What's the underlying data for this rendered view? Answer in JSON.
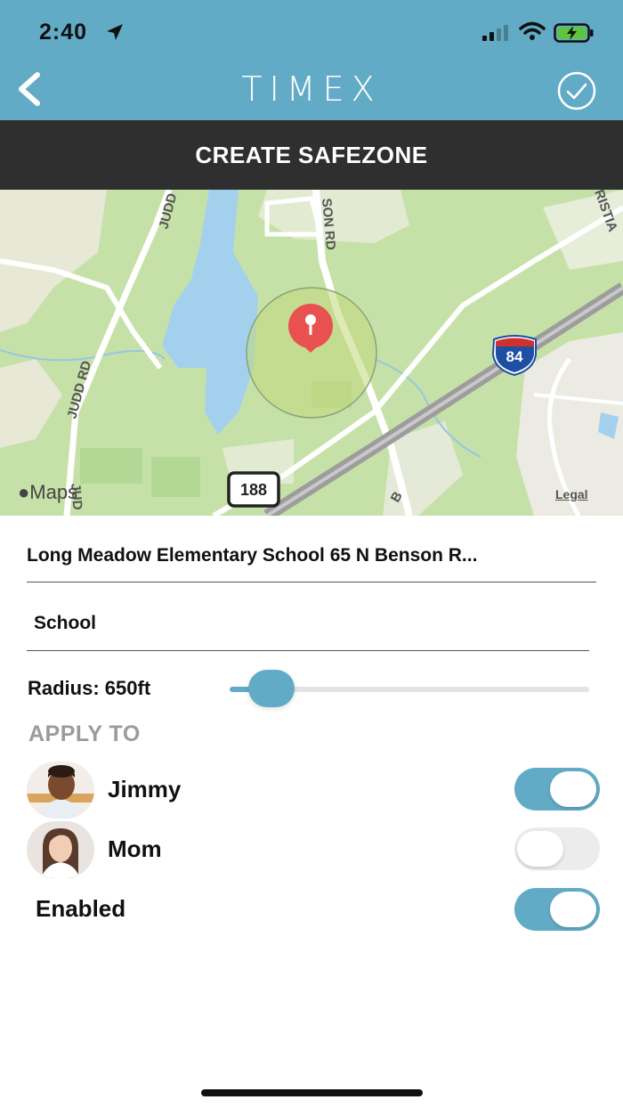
{
  "status_bar": {
    "time": "2:40",
    "icons": [
      "location-arrow-icon",
      "cellular-signal-icon",
      "wifi-icon",
      "battery-charging-icon"
    ]
  },
  "header": {
    "brand": "TIMEX",
    "back_icon": "chevron-left-icon",
    "confirm_icon": "check-circle-icon"
  },
  "title_bar": {
    "title": "CREATE SAFEZONE"
  },
  "map": {
    "road_labels": [
      "JUDD",
      "SON RD",
      "JUDD RD",
      "RISTIA",
      "JUD",
      "B"
    ],
    "interstate_shield": "84",
    "route_shield": "188",
    "attribution": "Maps",
    "legal": "Legal"
  },
  "form": {
    "address": "Long Meadow Elementary School 65 N Benson R...",
    "name": "School",
    "radius_label": "Radius: 650ft",
    "radius_fraction": 0.06
  },
  "apply_to": {
    "label": "APPLY TO",
    "people": [
      {
        "name": "Jimmy",
        "enabled": true
      },
      {
        "name": "Mom",
        "enabled": false
      }
    ]
  },
  "enabled": {
    "label": "Enabled",
    "value": true
  },
  "colors": {
    "header": "#62abc6",
    "title_bar": "#2f2f2f",
    "accent": "#62abc6",
    "pin": "#e8514f"
  }
}
